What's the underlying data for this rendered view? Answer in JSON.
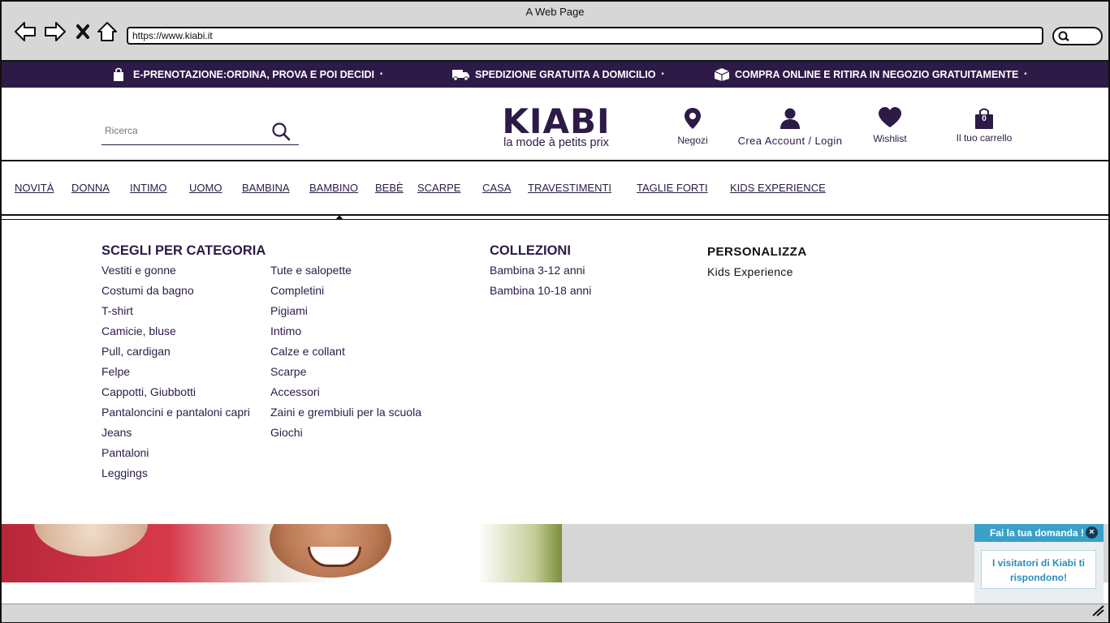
{
  "browser": {
    "window_title": "A Web Page",
    "url": "https://www.kiabi.it"
  },
  "promo": {
    "items": [
      {
        "icon": "shopping-bag-icon",
        "text": "E-PRENOTAZIONE:ORDINA, PROVA E POI DECIDI",
        "mark": "*"
      },
      {
        "icon": "truck-icon",
        "text": "SPEDIZIONE GRATUITA A DOMICILIO",
        "mark": "*"
      },
      {
        "icon": "box-icon",
        "text": "COMPRA ONLINE E RITIRA IN NEGOZIO GRATUITAMENTE",
        "mark": "*"
      }
    ]
  },
  "header": {
    "search_placeholder": "Ricerca",
    "logo_main": "KIABI",
    "logo_tagline": "la mode à petits prix",
    "stores_label": "Negozi",
    "account_label": "Crea Account / Login",
    "wishlist_label": "Wishlist",
    "cart_label": "Il tuo carrello",
    "cart_count": "0"
  },
  "nav": {
    "items": [
      "NOVITÀ",
      " DONNA",
      " INTIMO",
      " UOMO",
      " BAMBINA",
      "BAMBINO",
      "BEBÈ",
      " SCARPE",
      "CASA",
      " TRAVESTIMENTI",
      " TAGLIE FORTI",
      "KIDS EXPERIENCE"
    ]
  },
  "menu": {
    "category_heading": "SCEGLI PER CATEGORIA",
    "category_col1": [
      "Vestiti e gonne",
      "Costumi da bagno",
      "T-shirt",
      "Camicie, bluse",
      "Pull, cardigan",
      "Felpe",
      "Cappotti, Giubbotti",
      "Pantaloncini e pantaloni capri",
      "Jeans",
      "Pantaloni",
      "Leggings"
    ],
    "category_col2": [
      "Tute e salopette",
      "Completini",
      "Pigiami",
      "Intimo",
      "Calze e collant",
      "Scarpe",
      "Accessori",
      "Zaini e grembiuli per la scuola",
      "Giochi"
    ],
    "collections_heading": "COLLEZIONI",
    "collections": [
      "Bambina 3-12 anni",
      "Bambina 10-18 anni"
    ],
    "personalize_heading": "PERSONALIZZA",
    "personalize": [
      "Kids Experience"
    ]
  },
  "chat": {
    "header": "Fai la tua domanda !",
    "close": "×",
    "body": "I visitatori di Kiabi ti rispondono!"
  },
  "colors": {
    "brand_purple": "#2d1a47",
    "chat_blue": "#3aa0c8"
  }
}
